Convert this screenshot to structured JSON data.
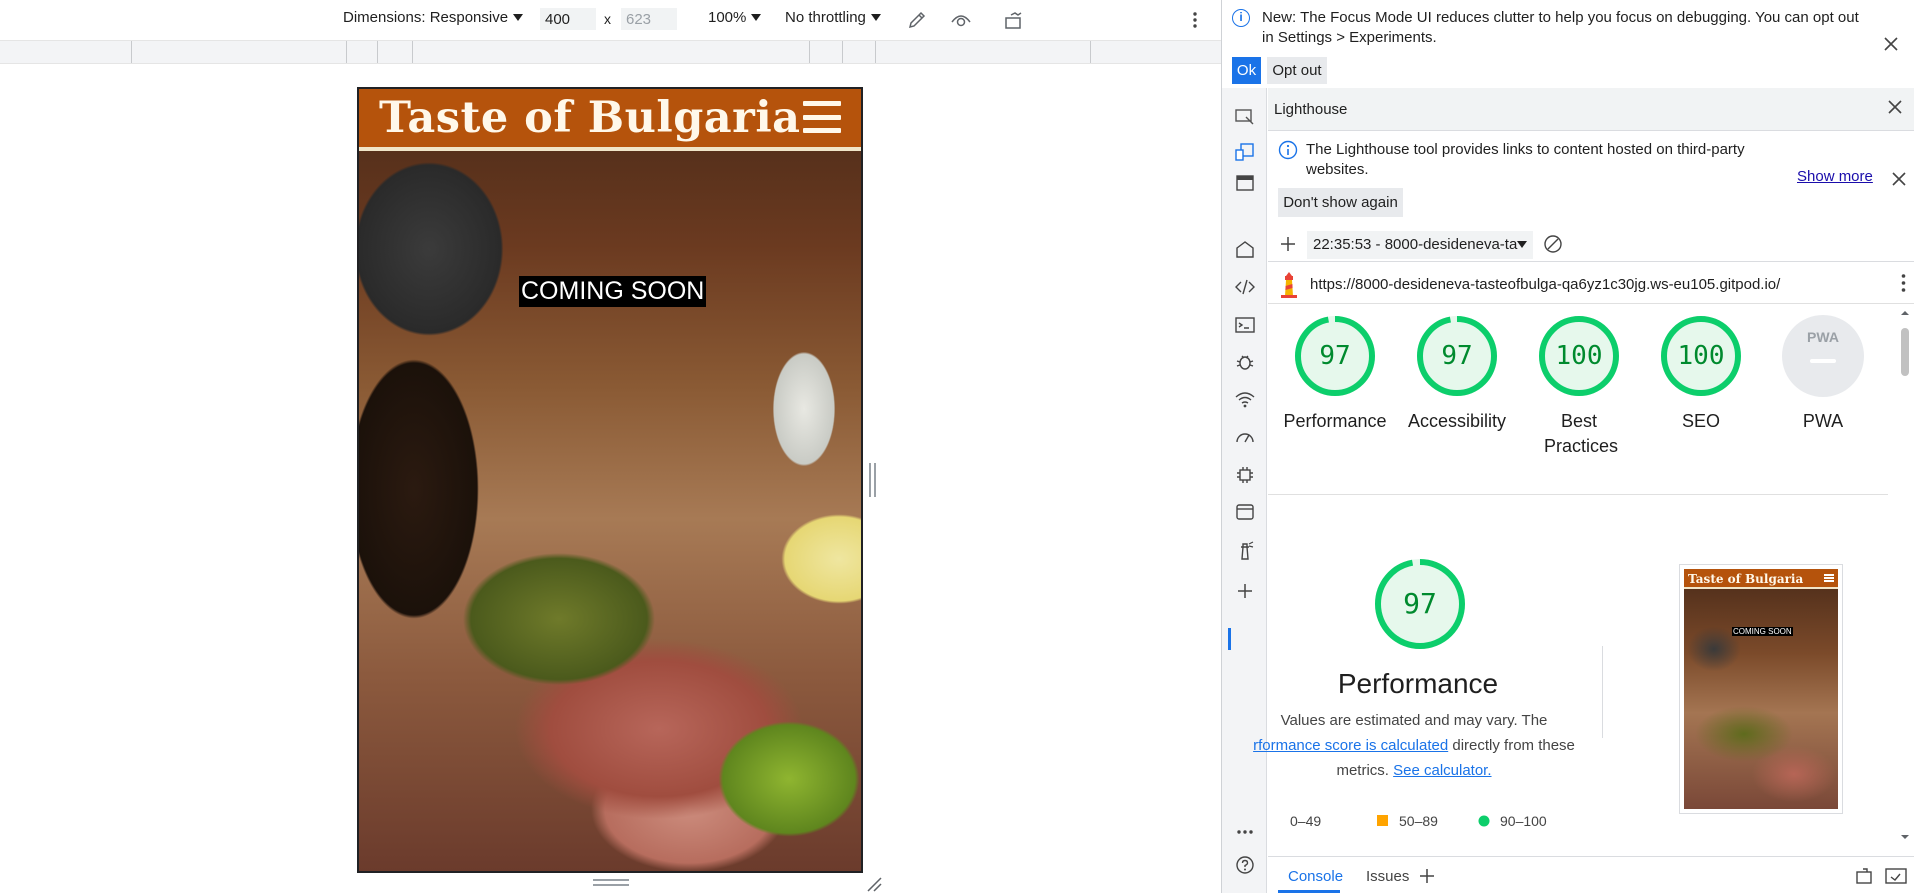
{
  "device_toolbar": {
    "dimensions_label": "Dimensions: Responsive",
    "width_value": "400",
    "height_placeholder": "623",
    "times": "x",
    "zoom": "100%",
    "throttling": "No throttling"
  },
  "page": {
    "site_title": "Taste of Bulgaria",
    "coming_soon": "COMING SOON"
  },
  "devtools": {
    "infobar_text": "New: The Focus Mode UI reduces clutter to help you focus on debugging. You can opt out in Settings > Experiments.",
    "ok_label": "Ok",
    "optout_label": "Opt out",
    "panel_title": "Lighthouse",
    "notice_text": "The Lighthouse tool provides links to content hosted on third-party websites.",
    "show_more": "Show more",
    "dont_show_again": "Don't show again",
    "report_select": "22:35:53 - 8000-desideneva-ta",
    "url": "https://8000-desideneva-tasteofbulga-qa6yz1c30jg.ws-eu105.gitpod.io/",
    "scores": [
      {
        "value": "97",
        "label": "Performance",
        "fraction": 0.97
      },
      {
        "value": "97",
        "label": "Accessibility",
        "fraction": 0.97
      },
      {
        "value": "100",
        "label": "Best Practices",
        "fraction": 1.0
      },
      {
        "value": "100",
        "label": "SEO",
        "fraction": 1.0
      }
    ],
    "pwa": {
      "badge": "PWA",
      "label": "PWA"
    },
    "perf_score": "97",
    "perf_fraction": 0.97,
    "perf_heading": "Performance",
    "perf_desc_1": "Values are estimated and may vary. The",
    "perf_link_1": "rformance score is calculated",
    "perf_desc_2": "directly from these metrics.",
    "perf_link_2": "See calculator.",
    "thumb_title": "Taste of Bulgaria",
    "thumb_coming_soon": "COMING SOON",
    "legend": {
      "fail": "0–49",
      "average": "50–89",
      "pass": "90–100"
    },
    "drawer": {
      "console": "Console",
      "issues": "Issues"
    },
    "colors": {
      "pass": "#0cce6b",
      "average": "#ffa400",
      "fail": "#ff4e42",
      "accent": "#1a73e8"
    }
  }
}
